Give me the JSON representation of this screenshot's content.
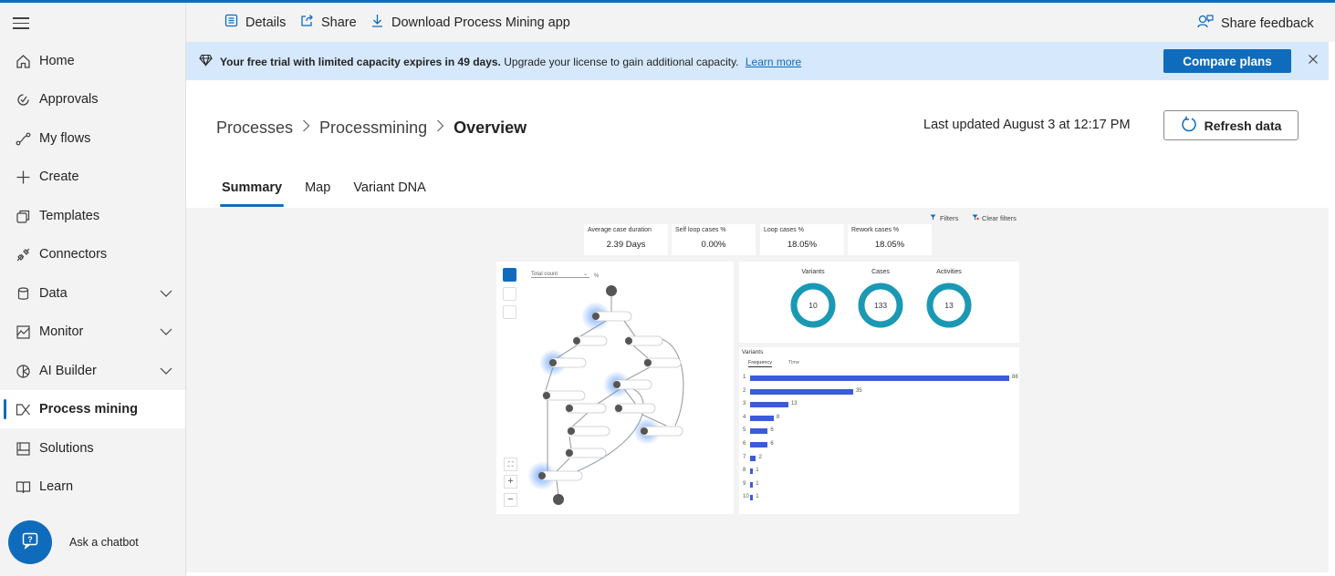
{
  "sidebar": {
    "items": [
      {
        "label": "Home",
        "icon": "home-icon"
      },
      {
        "label": "Approvals",
        "icon": "approvals-icon"
      },
      {
        "label": "My flows",
        "icon": "flows-icon"
      },
      {
        "label": "Create",
        "icon": "plus-icon"
      },
      {
        "label": "Templates",
        "icon": "templates-icon"
      },
      {
        "label": "Connectors",
        "icon": "connectors-icon"
      },
      {
        "label": "Data",
        "icon": "database-icon",
        "expandable": true
      },
      {
        "label": "Monitor",
        "icon": "monitor-icon",
        "expandable": true
      },
      {
        "label": "AI Builder",
        "icon": "ai-builder-icon",
        "expandable": true
      },
      {
        "label": "Process mining",
        "icon": "process-mining-icon",
        "active": true
      },
      {
        "label": "Solutions",
        "icon": "solutions-icon"
      },
      {
        "label": "Learn",
        "icon": "book-icon"
      }
    ],
    "chatbot_label": "Ask a chatbot"
  },
  "topbar": {
    "details": "Details",
    "share": "Share",
    "download": "Download Process Mining app",
    "feedback": "Share feedback"
  },
  "banner": {
    "bold": "Your free trial with limited capacity expires in 49 days.",
    "text": " Upgrade your license to gain additional capacity.",
    "link": "Learn more",
    "button": "Compare plans"
  },
  "header": {
    "breadcrumb": [
      "Processes",
      "Processmining",
      "Overview"
    ],
    "last_updated": "Last updated August 3 at 12:17 PM",
    "refresh": "Refresh data"
  },
  "tabs": [
    "Summary",
    "Map",
    "Variant DNA"
  ],
  "report": {
    "filters": "Filters",
    "clear_filters": "Clear filters",
    "kpis": [
      {
        "label": "Average case duration",
        "value": "2.39 Days"
      },
      {
        "label": "Self loop cases %",
        "value": "0.00%"
      },
      {
        "label": "Loop cases %",
        "value": "18.05%"
      },
      {
        "label": "Rework cases %",
        "value": "18.05%"
      }
    ],
    "map_dropdown": "Total count",
    "map_pct": "%",
    "donuts": [
      {
        "label": "Variants",
        "value": "10"
      },
      {
        "label": "Cases",
        "value": "133"
      },
      {
        "label": "Activities",
        "value": "13"
      }
    ],
    "variants_title": "Variants",
    "variants_tabs": [
      "Frequency",
      "Time"
    ],
    "variant_ranks": [
      "1",
      "2",
      "3",
      "4",
      "5",
      "6",
      "7",
      "8",
      "9",
      "10"
    ],
    "variant_values": [
      "88",
      "35",
      "13",
      "8",
      "6",
      "6",
      "2",
      "1",
      "1",
      "1"
    ],
    "accent_color": "#0f6cbd",
    "bar_color": "#3b5bdb",
    "donut_color": "#1b98b3"
  }
}
